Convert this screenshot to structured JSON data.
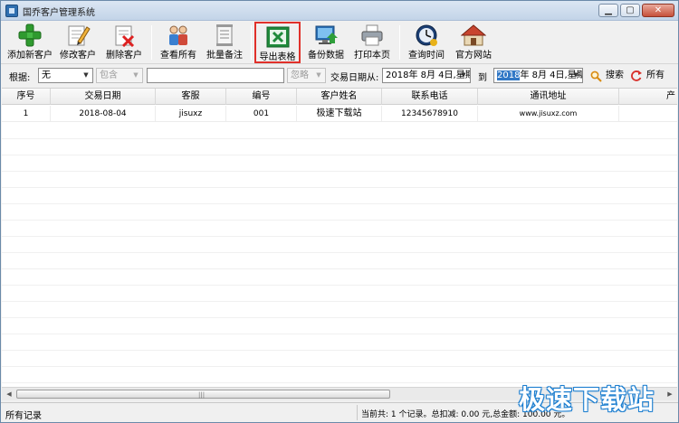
{
  "window": {
    "title": "国乔客户管理系统",
    "controls": [
      "minimize",
      "maximize",
      "close"
    ]
  },
  "toolbar": {
    "items": [
      {
        "label": "添加新客户",
        "icon": "add-customer-icon"
      },
      {
        "label": "修改客户",
        "icon": "edit-customer-icon"
      },
      {
        "label": "删除客户",
        "icon": "delete-customer-icon"
      },
      {
        "label": "查看所有",
        "icon": "view-all-icon"
      },
      {
        "label": "批量备注",
        "icon": "batch-note-icon"
      },
      {
        "label": "导出表格",
        "icon": "excel-export-icon",
        "highlighted": true
      },
      {
        "label": "备份数据",
        "icon": "backup-icon"
      },
      {
        "label": "打印本页",
        "icon": "printer-icon"
      },
      {
        "label": "查询时间",
        "icon": "clock-icon"
      },
      {
        "label": "官方网站",
        "icon": "home-icon"
      }
    ]
  },
  "filter": {
    "by_label": "根据:",
    "field_value": "无",
    "mode_value": "包含",
    "keyword_value": "",
    "ignore_value": "忽略",
    "date_from_label": "交易日期从:",
    "date_from": "2018年 8月 4日,星期",
    "date_to_label": "到",
    "date_to_sel": "2018",
    "date_to_rest": "年 8月 4日,星期",
    "search_label": "搜索",
    "all_label": "所有"
  },
  "table": {
    "columns": [
      "序号",
      "交易日期",
      "客服",
      "编号",
      "客户姓名",
      "联系电话",
      "通讯地址",
      "产"
    ],
    "rows": [
      [
        "1",
        "2018-08-04",
        "jisuxz",
        "001",
        "极速下载站",
        "12345678910",
        "www.jisuxz.com",
        ""
      ]
    ]
  },
  "status": {
    "left": "所有记录",
    "right": "当前共: 1 个记录。总扣减: 0.00 元,总金额: 100.00 元。"
  },
  "watermark": "极速下载站",
  "colors": {
    "highlight_border": "#e0302a",
    "date_selection": "#3178c6"
  }
}
